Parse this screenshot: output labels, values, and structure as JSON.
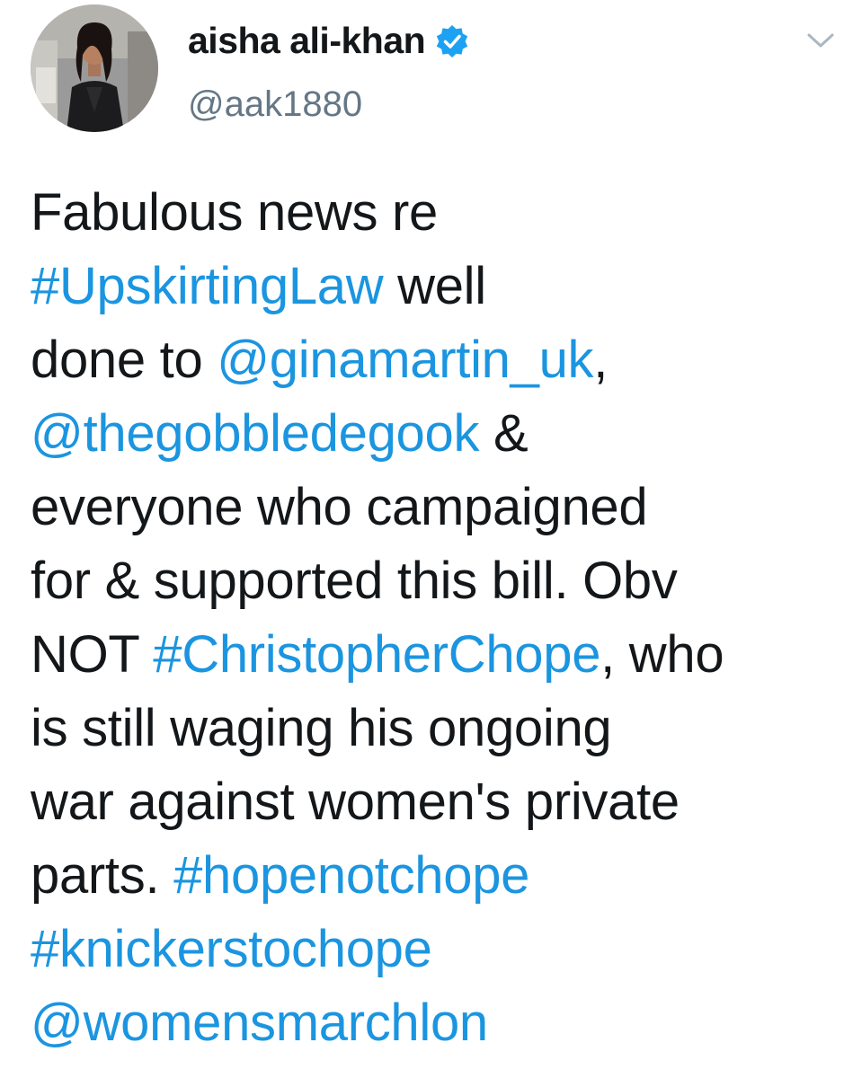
{
  "user": {
    "display_name": "aisha ali-khan",
    "handle": "@aak1880",
    "verified": true
  },
  "colors": {
    "text": "#14171a",
    "link": "#1b95e0",
    "secondary": "#657786",
    "verified_badge": "#1da1f2"
  },
  "icons": {
    "verified": "verified-badge-icon",
    "menu": "chevron-down-icon"
  },
  "tweet": {
    "lines": [
      [
        {
          "t": "Fabulous news re",
          "link": false
        }
      ],
      [
        {
          "t": "#UpskirtingLaw",
          "link": true
        },
        {
          "t": " well",
          "link": false
        }
      ],
      [
        {
          "t": "done to ",
          "link": false
        },
        {
          "t": "@ginamartin_uk",
          "link": true
        },
        {
          "t": ",",
          "link": false
        }
      ],
      [
        {
          "t": "@thegobbledegook",
          "link": true
        },
        {
          "t": " &",
          "link": false
        }
      ],
      [
        {
          "t": "everyone who campaigned",
          "link": false
        }
      ],
      [
        {
          "t": "for & supported this bill. Obv",
          "link": false
        }
      ],
      [
        {
          "t": "NOT ",
          "link": false
        },
        {
          "t": "#ChristopherChope",
          "link": true
        },
        {
          "t": ", who",
          "link": false
        }
      ],
      [
        {
          "t": "is still waging his ongoing",
          "link": false
        }
      ],
      [
        {
          "t": "war against women's private",
          "link": false
        }
      ],
      [
        {
          "t": "parts. ",
          "link": false
        },
        {
          "t": "#hopenotchope",
          "link": true
        }
      ],
      [
        {
          "t": "#knickerstochope",
          "link": true
        }
      ],
      [
        {
          "t": "@womensmarchlon",
          "link": true
        }
      ]
    ]
  }
}
